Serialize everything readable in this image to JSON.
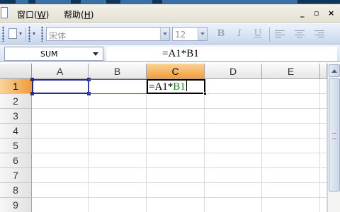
{
  "menu": {
    "items": [
      {
        "label": "窗口(",
        "key": "W",
        "suffix": ")"
      },
      {
        "label": "帮助(",
        "key": "H",
        "suffix": ")"
      }
    ],
    "window_controls": [
      "_",
      "▫",
      "×"
    ]
  },
  "toolbar": {
    "font_name": "宋体",
    "font_size": "12",
    "bold_label": "B",
    "italic_label": "I",
    "underline_label": "U"
  },
  "formula_bar": {
    "name_box": "SUM",
    "formula": "=A1*B1"
  },
  "sheet": {
    "columns": [
      "A",
      "B",
      "C",
      "D",
      "E"
    ],
    "rows": [
      "1",
      "2",
      "3",
      "4",
      "5",
      "6",
      "7",
      "8",
      "9"
    ],
    "active_column": "C",
    "active_row": "1",
    "active_cell": {
      "text_prefix": "=A1*",
      "text_ref": "B1"
    }
  },
  "colors": {
    "ref_a1_border": "#1a2f9a",
    "ref_b1_border": "#2f8a2f",
    "active_header": "#f29c3a"
  }
}
